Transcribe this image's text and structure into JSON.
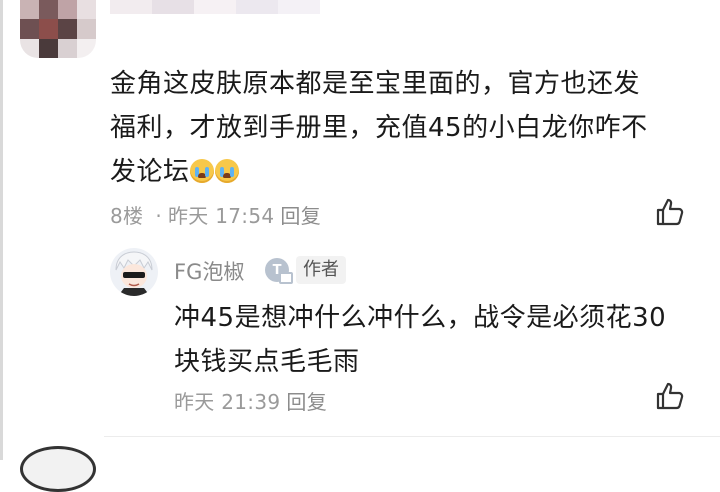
{
  "comment": {
    "text_line1": "金角这皮肤原本都是至宝里面的，官方也还发",
    "text_line2": "福利，才放到手册里，充值45的小白龙你咋不",
    "text_line3": "发论坛",
    "emojis": [
      "crying-emoji",
      "crying-emoji"
    ],
    "floor": "8楼",
    "time": "昨天 17:54",
    "reply_label": "回复"
  },
  "reply": {
    "author": "FG泡椒",
    "level_badge": "T",
    "author_tag": "作者",
    "text_line1": "冲45是想冲什么冲什么，战令是必须花30",
    "text_line2": "块钱买点毛毛雨",
    "time": "昨天 21:39",
    "reply_label": "回复"
  },
  "colors": {
    "text": "#1a1a1a",
    "meta": "#9a9a9a",
    "badge_bg": "#f2f2f2"
  },
  "icons": [
    "thumbs-up-icon",
    "level-badge-icon"
  ]
}
